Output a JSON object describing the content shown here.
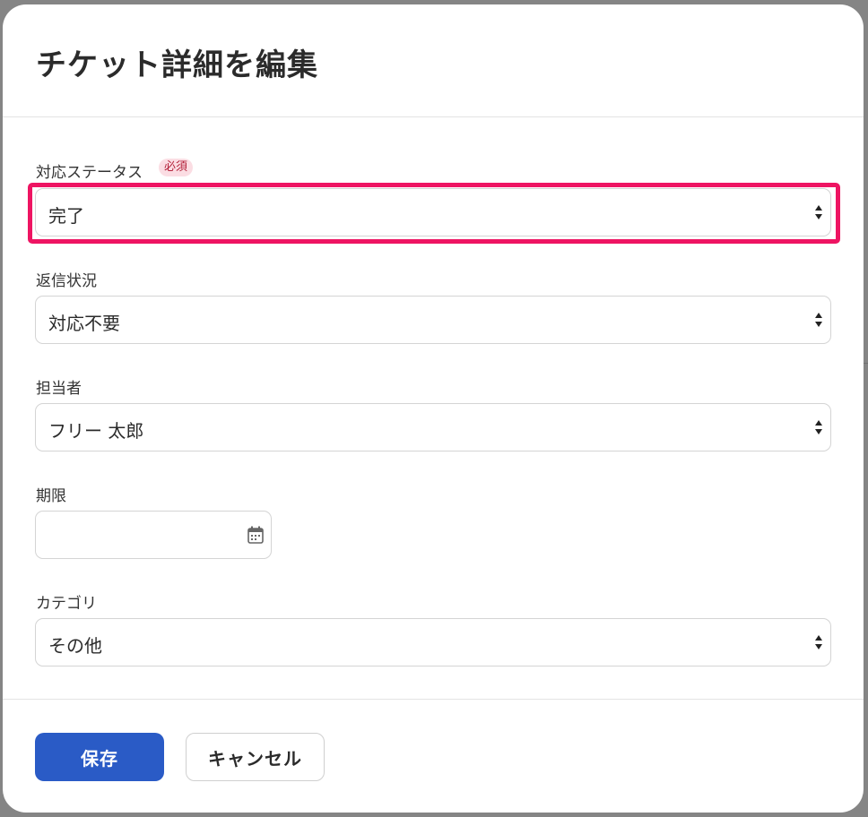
{
  "dialog": {
    "title": "チケット詳細を編集"
  },
  "fields": {
    "status": {
      "label": "対応ステータス",
      "required_badge": "必須",
      "value": "完了"
    },
    "reply_status": {
      "label": "返信状況",
      "value": "対応不要"
    },
    "assignee": {
      "label": "担当者",
      "value": "フリー 太郎"
    },
    "due_date": {
      "label": "期限",
      "value": "",
      "icon": "calendar-icon"
    },
    "category": {
      "label": "カテゴリ",
      "value": "その他"
    }
  },
  "footer": {
    "save_label": "保存",
    "cancel_label": "キャンセル"
  },
  "colors": {
    "primary": "#2a5bc6",
    "highlight": "#ee1462",
    "required_badge_bg": "#fbdde3",
    "required_badge_text": "#b4233c"
  }
}
